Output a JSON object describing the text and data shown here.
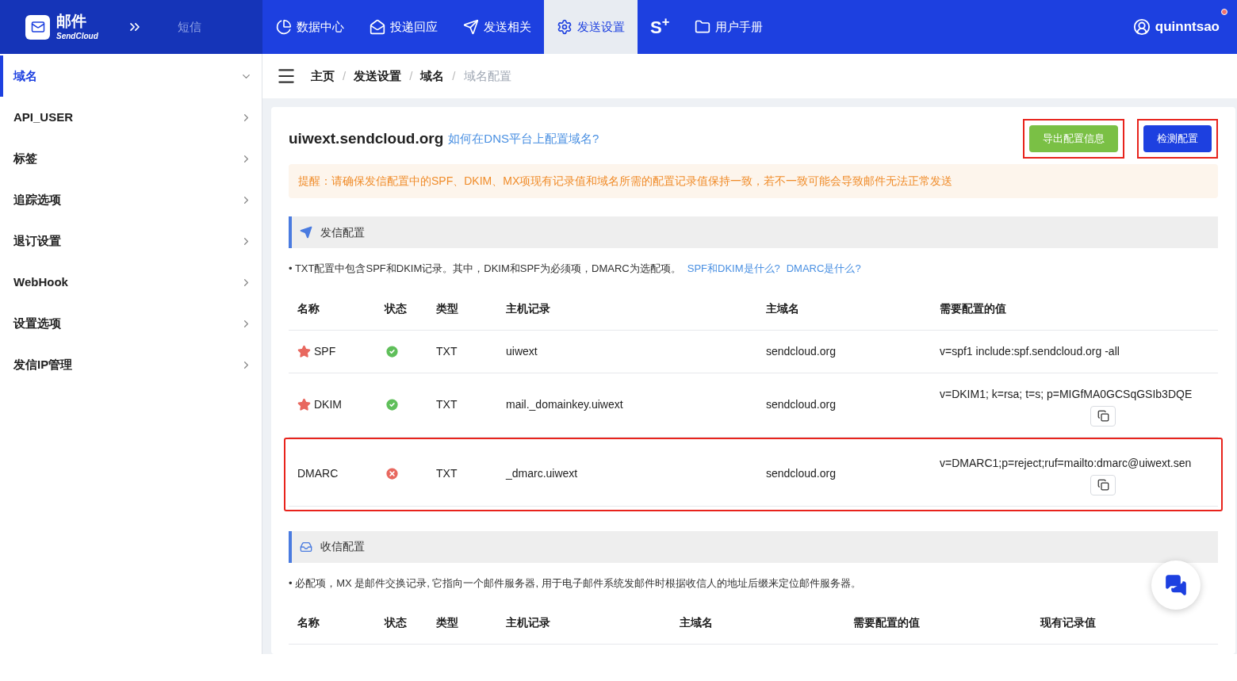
{
  "brand": {
    "title": "邮件",
    "subtitle": "SendCloud",
    "other_product": "短信"
  },
  "nav": [
    {
      "kind": "pie",
      "label": "数据中心",
      "selected": false
    },
    {
      "kind": "mail",
      "label": "投递回应",
      "selected": false
    },
    {
      "kind": "send",
      "label": "发送相关",
      "selected": false
    },
    {
      "kind": "gear",
      "label": "发送设置",
      "selected": true
    },
    {
      "kind": "logo",
      "label": "S$^{+}$",
      "selected": false
    },
    {
      "kind": "folder",
      "label": "用户手册",
      "selected": false
    }
  ],
  "user": {
    "name": "quinntsao",
    "notification": true
  },
  "sidebar": {
    "items": [
      {
        "label": "域名",
        "selected": true,
        "expanded": true
      },
      {
        "label": "API_USER",
        "selected": false,
        "expanded": false
      },
      {
        "label": "标签",
        "selected": false,
        "expanded": false
      },
      {
        "label": "追踪选项",
        "selected": false,
        "expanded": false
      },
      {
        "label": "退订设置",
        "selected": false,
        "expanded": false
      },
      {
        "label": "WebHook",
        "selected": false,
        "expanded": false
      },
      {
        "label": "设置选项",
        "selected": false,
        "expanded": false
      },
      {
        "label": "发信IP管理",
        "selected": false,
        "expanded": false
      }
    ]
  },
  "breadcrumb": [
    "主页",
    "发送设置",
    "域名",
    "域名配置"
  ],
  "breadcrumb_separator": "/",
  "domain": {
    "name": "uiwext.sendcloud.org",
    "help_link": "如何在DNS平台上配置域名?"
  },
  "actions": [
    {
      "kind": "export",
      "label": "导出配置信息",
      "highlighted": true
    },
    {
      "kind": "check",
      "label": "检测配置",
      "highlighted": true
    }
  ],
  "notice": "提醒：请确保发信配置中的SPF、DKIM、MX项现有记录值和域名所需的配置记录值保持一致，若不一致可能会导致邮件无法正常发送",
  "send_section": {
    "title": "发信配置",
    "note": "• TXT配置中包含SPF和DKIM记录。其中，DKIM和SPF为必须项，DMARC为选配项。",
    "links": [
      "SPF和DKIM是什么?",
      "DMARC是什么?"
    ],
    "columns": [
      "名称",
      "状态",
      "类型",
      "主机记录",
      "主域名",
      "需要配置的值"
    ],
    "rows": [
      {
        "name": "SPF",
        "required": true,
        "ok": true,
        "type": "TXT",
        "host": "uiwext",
        "domain": "sendcloud.org",
        "value": "v=spf1 include:spf.sendcloud.org -all",
        "copyable": false,
        "highlighted": false
      },
      {
        "name": "DKIM",
        "required": true,
        "ok": true,
        "type": "TXT",
        "host": "mail._domainkey.uiwext",
        "domain": "sendcloud.org",
        "value": "v=DKIM1; k=rsa; t=s; p=MIGfMA0GCSqGSIb3DQE",
        "copyable": true,
        "highlighted": false
      },
      {
        "name": "DMARC",
        "required": false,
        "ok": false,
        "type": "TXT",
        "host": "_dmarc.uiwext",
        "domain": "sendcloud.org",
        "value": "v=DMARC1;p=reject;ruf=mailto:dmarc@uiwext.sen",
        "copyable": true,
        "highlighted": true
      }
    ]
  },
  "receive_section": {
    "title": "收信配置",
    "note": "• 必配项，MX 是邮件交换记录, 它指向一个邮件服务器, 用于电子邮件系统发邮件时根据收信人的地址后缀来定位邮件服务器。",
    "columns": [
      "名称",
      "状态",
      "类型",
      "主机记录",
      "主域名",
      "需要配置的值",
      "现有记录值"
    ]
  }
}
